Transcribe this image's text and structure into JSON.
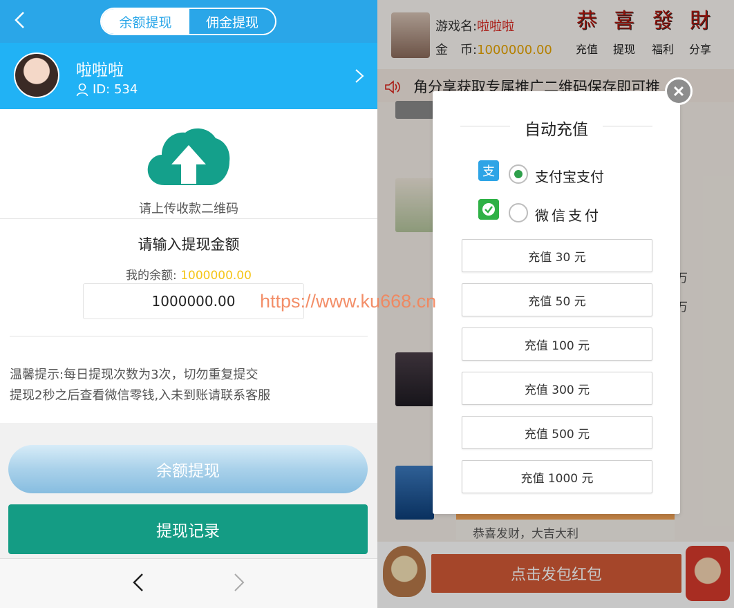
{
  "left": {
    "tabs": {
      "balance": "余额提现",
      "commission": "佣金提现"
    },
    "profile": {
      "name": "啦啦啦",
      "id": "ID: 534"
    },
    "upload_label": "请上传收款二维码",
    "amount_title": "请输入提现金额",
    "balance_label": "我的余额: ",
    "balance_value": "1000000.00",
    "amount_input": "1000000.00",
    "tips": [
      "温馨提示:每日提现次数为3次，切勿重复提交",
      "提现2秒之后查看微信零钱,入未到账请联系客服"
    ],
    "buttons": {
      "balance_withdraw": "余额提现",
      "withdraw_records": "提现记录"
    }
  },
  "right": {
    "game_name_label": "游戏名:",
    "game_name": "啦啦啦",
    "coins_label": "金　币:",
    "coins": "1000000.00",
    "actions": [
      {
        "glyph": "恭",
        "label": "充值"
      },
      {
        "glyph": "喜",
        "label": "提现"
      },
      {
        "glyph": "發",
        "label": "福利"
      },
      {
        "glyph": "財",
        "label": "分享"
      }
    ],
    "notice": "角分享获取专属推广二维码保存即可推",
    "feed_fragments": [
      "万",
      "万"
    ],
    "feed_card_text": "恭喜发财，大吉大利",
    "red_packet_button": "点击发包红包",
    "modal": {
      "title": "自动充值",
      "pay_methods": [
        "支付宝支付",
        "微信支付"
      ],
      "selected_method": "支付宝支付",
      "amounts": [
        "充值 30 元",
        "充值 50 元",
        "充值 100 元",
        "充值 300 元",
        "充值 500 元",
        "充值 1000 元"
      ]
    }
  },
  "watermark": "https://www.ku668.cn",
  "colors": {
    "header_blue": "#2aa6e8",
    "profile_blue": "#21b2f5",
    "teal": "#149c84",
    "balance_yellow": "#f5c518",
    "red": "#d9231b",
    "coin_gold": "#e7a400",
    "red_packet": "#d45a36",
    "radio_green": "#2ea04b"
  }
}
